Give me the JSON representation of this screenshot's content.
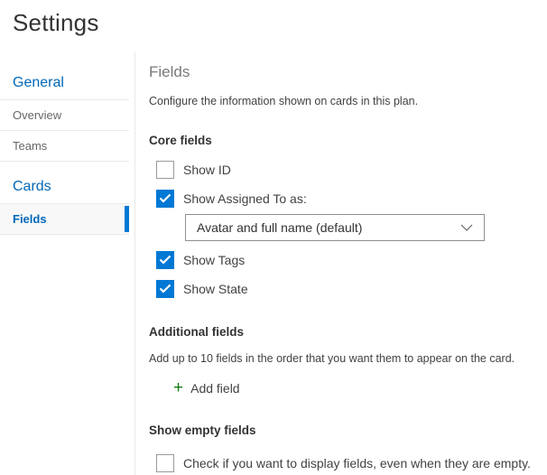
{
  "page": {
    "title": "Settings"
  },
  "sidebar": {
    "groups": [
      {
        "heading": "General",
        "items": [
          {
            "label": "Overview",
            "selected": false
          },
          {
            "label": "Teams",
            "selected": false
          }
        ]
      },
      {
        "heading": "Cards",
        "items": [
          {
            "label": "Fields",
            "selected": true
          }
        ]
      }
    ]
  },
  "content": {
    "heading": "Fields",
    "description": "Configure the information shown on cards in this plan.",
    "core_fields": {
      "heading": "Core fields",
      "checkboxes": [
        {
          "label": "Show ID",
          "checked": false
        },
        {
          "label": "Show Assigned To as:",
          "checked": true
        },
        {
          "label": "Show Tags",
          "checked": true
        },
        {
          "label": "Show State",
          "checked": true
        }
      ],
      "assigned_to_dropdown": {
        "value": "Avatar and full name (default)"
      }
    },
    "additional_fields": {
      "heading": "Additional fields",
      "description": "Add up to 10 fields in the order that you want them to appear on the card.",
      "add_field_label": "Add field",
      "plus_glyph": "+"
    },
    "show_empty_fields": {
      "heading": "Show empty fields",
      "checkbox": {
        "label": "Check if you want to display fields, even when they are empty.",
        "checked": false
      }
    }
  },
  "colors": {
    "accent_blue": "#0078d4",
    "link_blue": "#0067b8",
    "plus_green": "#107c10",
    "heading_gray": "#7a7a7a",
    "text_dark": "#333333",
    "text_body": "#424242",
    "divider": "#eaeaea"
  }
}
